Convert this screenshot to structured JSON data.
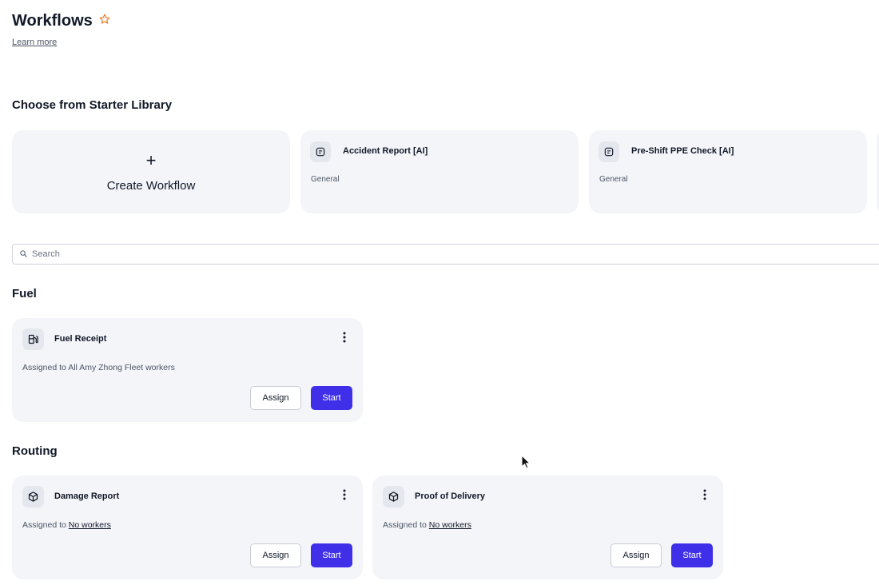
{
  "header": {
    "title": "Workflows",
    "learn_more": "Learn more"
  },
  "starter_library": {
    "title": "Choose from Starter Library",
    "create_label": "Create Workflow",
    "templates": [
      {
        "title": "Accident Report [AI]",
        "category": "General",
        "icon": "form-icon"
      },
      {
        "title": "Pre-Shift PPE Check [AI]",
        "category": "General",
        "icon": "form-icon"
      }
    ]
  },
  "search": {
    "placeholder": "Search",
    "value": ""
  },
  "groups": [
    {
      "name": "Fuel",
      "workflows": [
        {
          "title": "Fuel Receipt",
          "icon": "fuel-pump-icon",
          "assigned_prefix": "Assigned to ",
          "assigned_target": "All Amy Zhong Fleet workers",
          "assign_label": "Assign",
          "start_label": "Start"
        }
      ]
    },
    {
      "name": "Routing",
      "workflows": [
        {
          "title": "Damage Report",
          "icon": "package-icon",
          "assigned_prefix": "Assigned to ",
          "assigned_target": "No workers",
          "assign_label": "Assign",
          "start_label": "Start"
        },
        {
          "title": "Proof of Delivery",
          "icon": "package-icon",
          "assigned_prefix": "Assigned to ",
          "assigned_target": "No workers",
          "assign_label": "Assign",
          "start_label": "Start"
        }
      ]
    }
  ],
  "colors": {
    "accent": "#3f2fe8",
    "card_bg": "#f4f5f9",
    "star": "#ea7c28"
  }
}
